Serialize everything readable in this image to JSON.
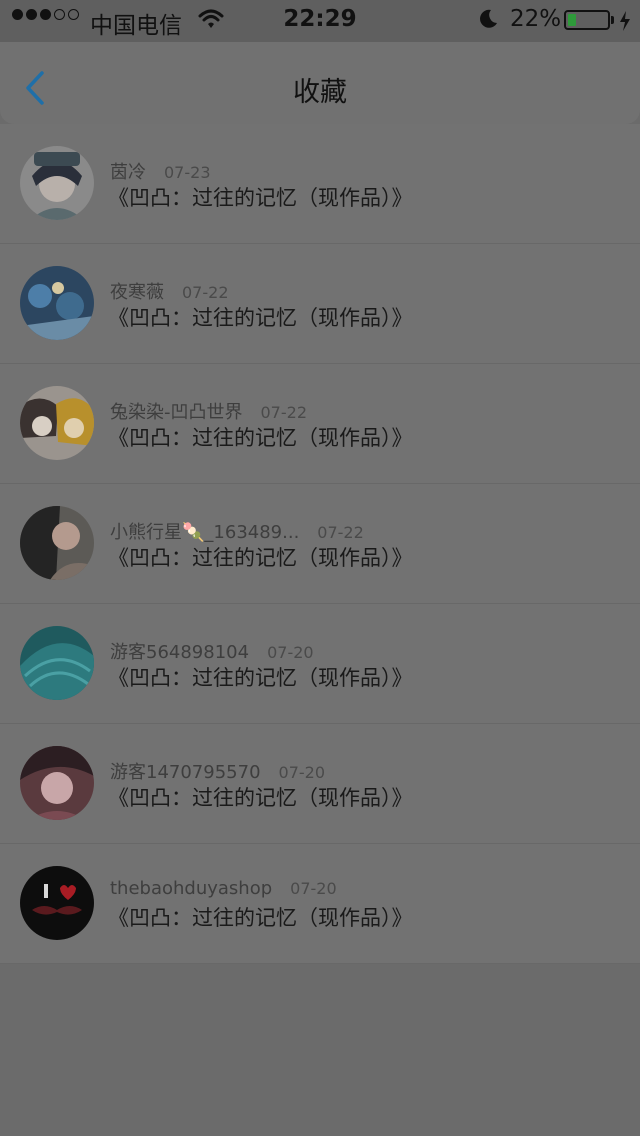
{
  "status_bar": {
    "carrier": "中国电信",
    "time": "22:29",
    "battery_percent": "22%",
    "battery_level": 0.22,
    "signal_bars_filled": 3,
    "signal_bars_total": 5
  },
  "nav": {
    "title": "收藏"
  },
  "favorites": [
    {
      "user": "茵冷",
      "date": "07-23",
      "work": "《凹凸：过往的记忆（现作品）》",
      "avatar": "anime-avatar-1"
    },
    {
      "user": "夜寒薇",
      "date": "07-22",
      "work": "《凹凸：过往的记忆（现作品）》",
      "avatar": "anime-avatar-2"
    },
    {
      "user": "兔染染-凹凸世界",
      "date": "07-22",
      "work": "《凹凸：过往的记忆（现作品）》",
      "avatar": "anime-avatar-3"
    },
    {
      "user": "小熊行星🍡_163489...",
      "date": "07-22",
      "work": "《凹凸：过往的记忆（现作品）》",
      "avatar": "photo-avatar-1"
    },
    {
      "user": "游客564898104",
      "date": "07-20",
      "work": "《凹凸：过往的记忆（现作品）》",
      "avatar": "teal-avatar"
    },
    {
      "user": "游客1470795570",
      "date": "07-20",
      "work": "《凹凸：过往的记忆（现作品）》",
      "avatar": "photo-avatar-2"
    },
    {
      "user": "thebaohduyashop",
      "date": "07-20",
      "work": "《凹凸：过往的记忆（现作品）》",
      "avatar": "i-love-avatar"
    }
  ],
  "colors": {
    "back_arrow": "#1f6fa8",
    "battery_fill": "#2e9a3a"
  }
}
